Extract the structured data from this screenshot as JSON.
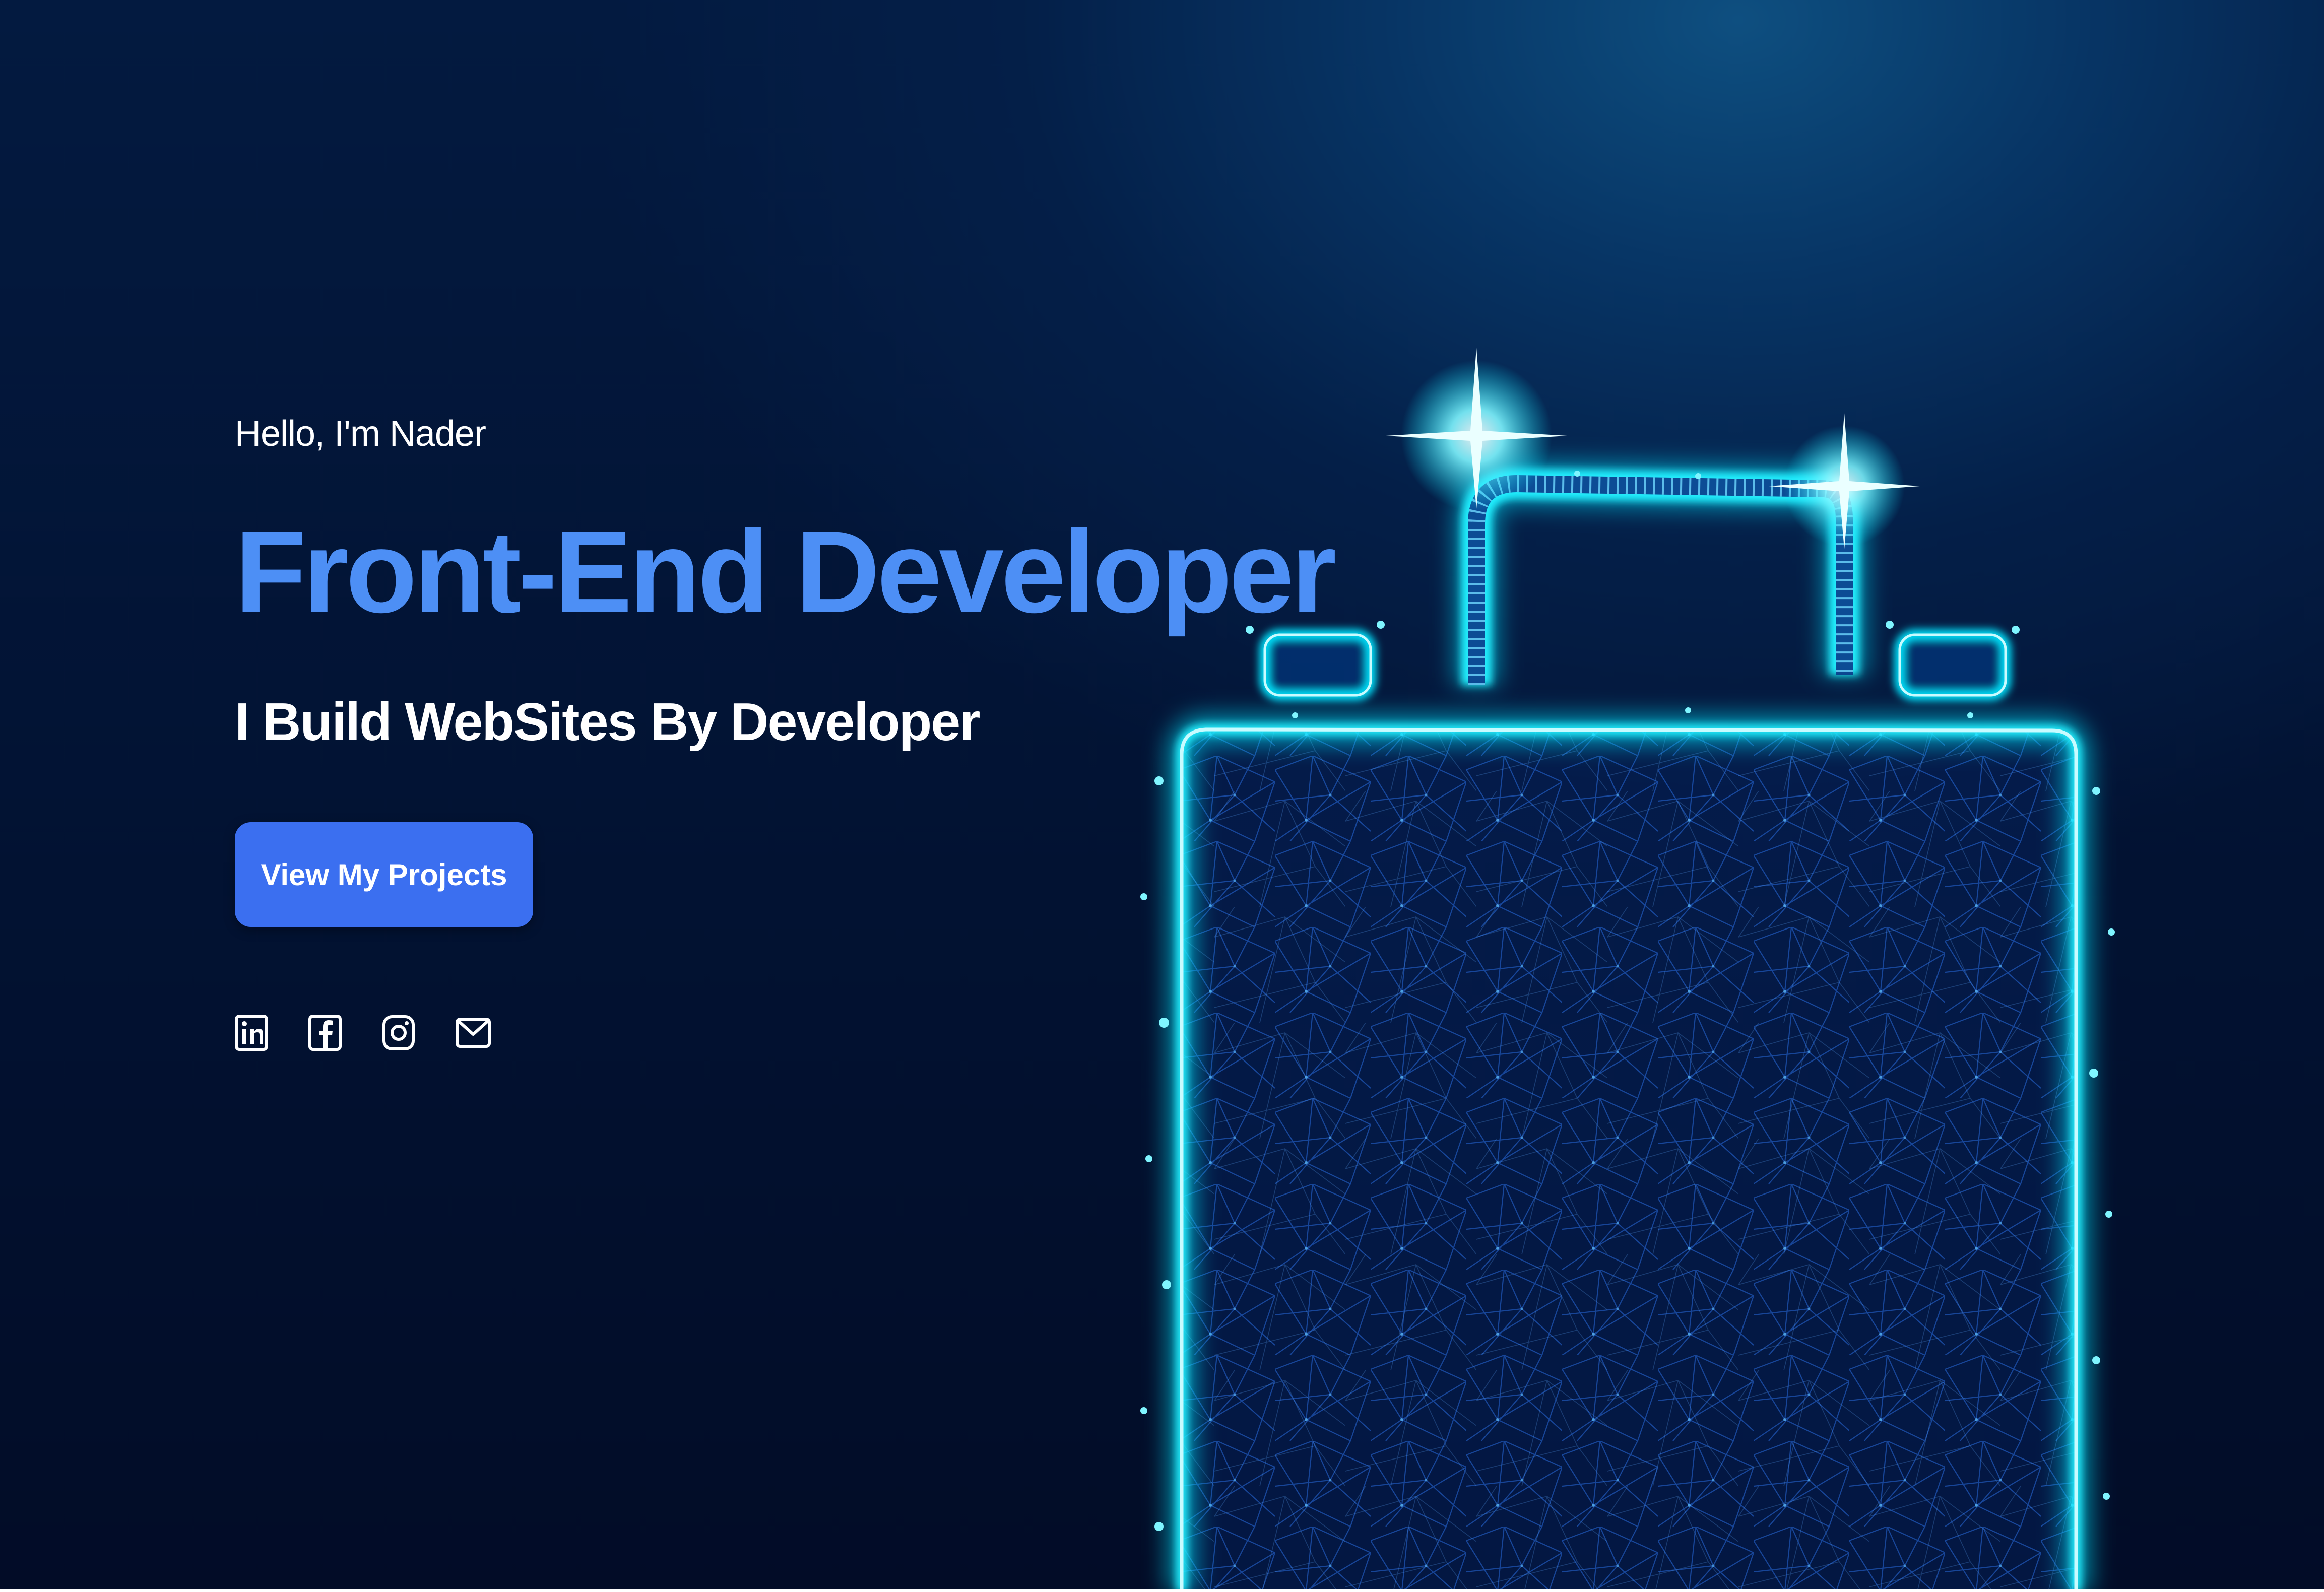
{
  "hero": {
    "greeting": "Hello, I'm Nader",
    "title": "Front-End Developer",
    "tagline": "I Build WebSites By Developer",
    "cta_label": "View My Projects"
  },
  "social": [
    {
      "icon": "linkedin-icon"
    },
    {
      "icon": "facebook-icon"
    },
    {
      "icon": "instagram-icon"
    },
    {
      "icon": "email-icon"
    }
  ],
  "colors": {
    "background": "#03102a",
    "title": "#4d8ff5",
    "button": "#3b6ff0",
    "glow": "#00e5ff",
    "text": "#ffffff"
  },
  "illustration": {
    "subject": "glowing wireframe suitcase"
  }
}
